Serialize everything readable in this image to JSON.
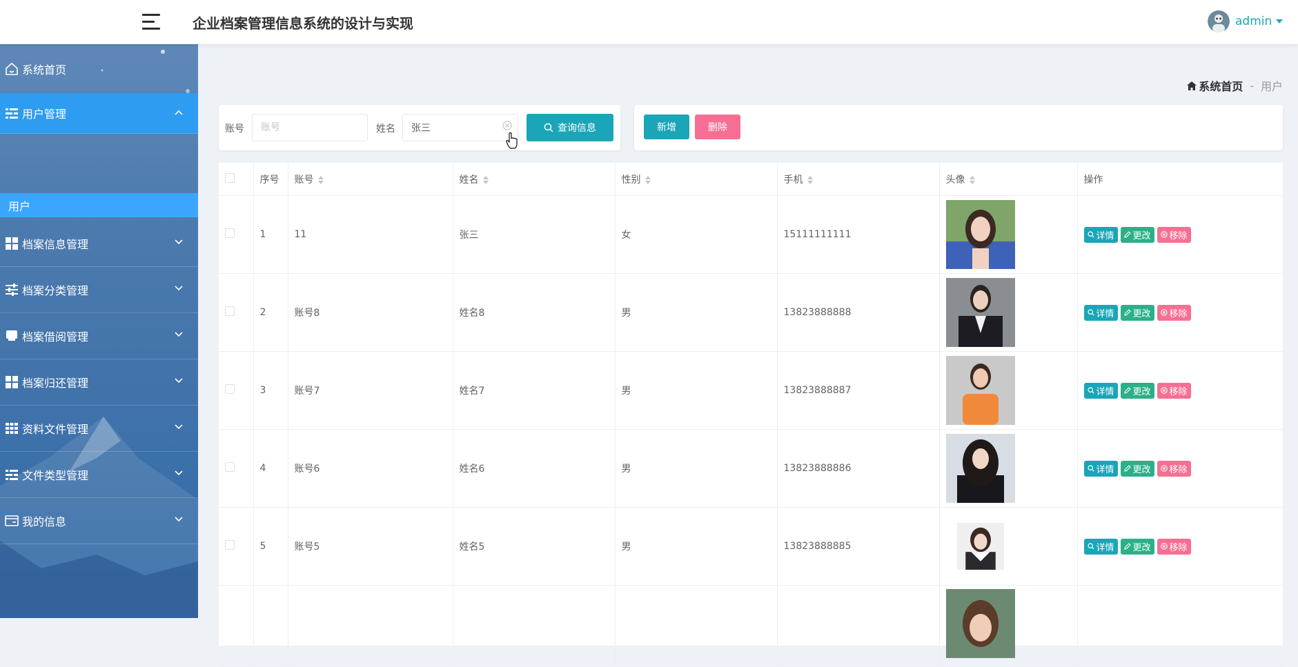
{
  "header": {
    "title": "企业档案管理信息系统的设计与实现",
    "username": "admin"
  },
  "sidebar": {
    "items": [
      {
        "label": "系统首页",
        "icon": "home-icon"
      },
      {
        "label": "用户管理",
        "icon": "list-icon"
      },
      {
        "label": "档案信息管理",
        "icon": "grid-icon"
      },
      {
        "label": "档案分类管理",
        "icon": "sliders-icon"
      },
      {
        "label": "档案借阅管理",
        "icon": "inbox-icon"
      },
      {
        "label": "档案归还管理",
        "icon": "grid-icon"
      },
      {
        "label": "资料文件管理",
        "icon": "apps-icon"
      },
      {
        "label": "文件类型管理",
        "icon": "list-icon"
      },
      {
        "label": "我的信息",
        "icon": "card-icon"
      }
    ],
    "sub_item": "用户"
  },
  "breadcrumb": {
    "home": "系统首页",
    "separator": "-",
    "current": "用户"
  },
  "search": {
    "account_label": "账号",
    "account_placeholder": "账号",
    "account_value": "",
    "name_label": "姓名",
    "name_value": "张三",
    "query_button": "查询信息"
  },
  "actions": {
    "add_button": "新增",
    "delete_button": "删除"
  },
  "table": {
    "columns": [
      "序号",
      "账号",
      "姓名",
      "性别",
      "手机",
      "头像",
      "操作"
    ],
    "rows": [
      {
        "index": "1",
        "account": "11",
        "name": "张三",
        "gender": "女",
        "phone": "15111111111"
      },
      {
        "index": "2",
        "account": "账号8",
        "name": "姓名8",
        "gender": "男",
        "phone": "13823888888"
      },
      {
        "index": "3",
        "account": "账号7",
        "name": "姓名7",
        "gender": "男",
        "phone": "13823888887"
      },
      {
        "index": "4",
        "account": "账号6",
        "name": "姓名6",
        "gender": "男",
        "phone": "13823888886"
      },
      {
        "index": "5",
        "account": "账号5",
        "name": "姓名5",
        "gender": "男",
        "phone": "13823888885"
      },
      {
        "index": "",
        "account": "",
        "name": "",
        "gender": "",
        "phone": ""
      }
    ],
    "ops": {
      "detail": "详情",
      "edit": "更改",
      "remove": "移除"
    }
  },
  "colors": {
    "accent": "#1ba5b8",
    "danger": "#f66f93",
    "edit": "#2bb089",
    "sidebar_active": "#2e9cf0",
    "submenu": "#3aa6ff"
  }
}
